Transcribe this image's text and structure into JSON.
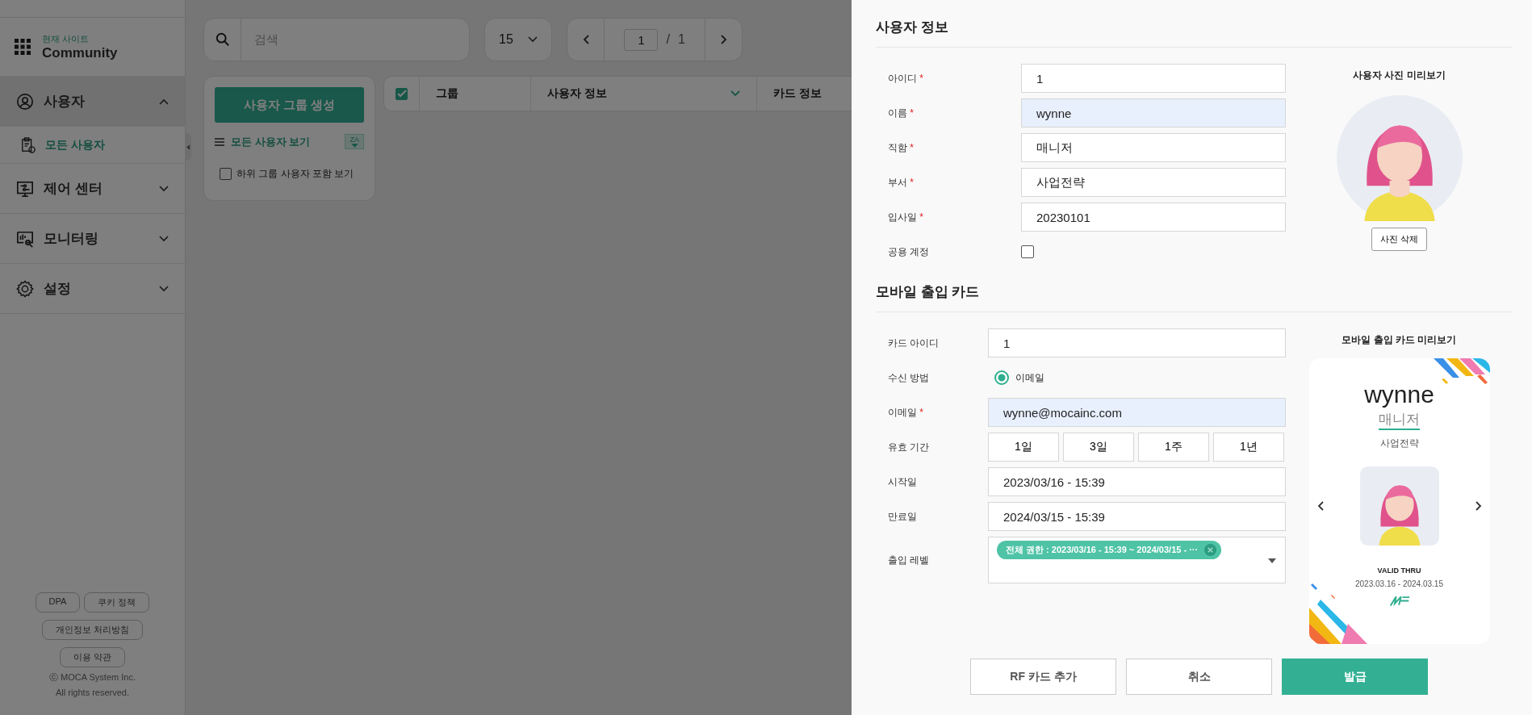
{
  "sidebar": {
    "site_label": "현재 사이트",
    "site_name": "Community",
    "menu": [
      {
        "label": "사용자",
        "kind": "user",
        "expanded": true,
        "children": [
          {
            "label": "모든 사용자",
            "selected": true
          }
        ]
      },
      {
        "label": "제어 센터",
        "kind": "control",
        "expanded": false
      },
      {
        "label": "모니터링",
        "kind": "monitor",
        "expanded": false
      },
      {
        "label": "설정",
        "kind": "settings",
        "expanded": false
      }
    ],
    "footer_links": [
      [
        "DPA",
        "쿠키 정책"
      ],
      [
        "개인정보 처리방침"
      ],
      [
        "이용 약관"
      ]
    ],
    "copyright": [
      "ⓒ MOCA System Inc.",
      "All rights reserved."
    ]
  },
  "toolbar": {
    "search": {
      "placeholder": "검색"
    },
    "page_size": "15",
    "page": "1",
    "page_sep": "/",
    "total_pages": "1"
  },
  "group_panel": {
    "create_button": "사용자 그룹 생성",
    "view_all": "모든 사용자 보기",
    "sort_badge": "ZA",
    "include_subgroups": {
      "label": "하위 그룹 사용자 포함 보기",
      "checked": false
    }
  },
  "table": {
    "select_all_checked": true,
    "columns": [
      {
        "label": "그룹",
        "sortable": false
      },
      {
        "label": "사용자 정보",
        "sortable": true
      },
      {
        "label": "카드 정보",
        "sortable": false
      }
    ]
  },
  "user_info": {
    "title": "사용자 정보",
    "rows": [
      {
        "kind": "text",
        "label": "아이디",
        "mark": "*",
        "value": "1",
        "autofilled": false
      },
      {
        "kind": "text",
        "label": "이름",
        "mark": "*",
        "value": "wynne",
        "autofilled": true
      },
      {
        "kind": "text",
        "label": "직함",
        "mark": "*",
        "value": "매니저",
        "autofilled": false
      },
      {
        "kind": "text",
        "label": "부서",
        "mark": "*",
        "value": "사업전략",
        "autofilled": false
      },
      {
        "kind": "text",
        "label": "입사일",
        "mark": "*",
        "value": "20230101",
        "autofilled": false
      },
      {
        "kind": "checkbox",
        "label": "공용 계정",
        "checked": false
      }
    ],
    "preview": {
      "title": "사용자 사진 미리보기",
      "delete_button": "사진 삭제"
    }
  },
  "mobile_card": {
    "title": "모바일 출입 카드",
    "rows": [
      {
        "kind": "text",
        "label": "카드 아이디",
        "value": "1",
        "autofilled": false
      },
      {
        "kind": "radio",
        "label": "수신 방법",
        "options": [
          {
            "label": "이메일",
            "selected": true
          }
        ]
      },
      {
        "kind": "text",
        "label": "이메일",
        "mark": "*",
        "value": "wynne@mocainc.com",
        "autofilled": true
      },
      {
        "kind": "period",
        "label": "유효 기간",
        "options": [
          "1일",
          "3일",
          "1주",
          "1년"
        ]
      },
      {
        "kind": "text",
        "label": "시작일",
        "value": "2023/03/16 - 15:39",
        "autofilled": false
      },
      {
        "kind": "text",
        "label": "만료일",
        "value": "2024/03/15 - 15:39",
        "autofilled": false
      },
      {
        "kind": "tags",
        "label": "출입 레벨",
        "tags": [
          "전체 권한 : 2023/03/16 - 15:39 ~ 2024/03/15 - ···"
        ]
      }
    ],
    "preview": {
      "title": "모바일 출입 카드 미리보기",
      "name": "wynne",
      "position": "매니저",
      "department": "사업전략",
      "valid_label": "VALID THRU",
      "valid_range": "2023.03.16 - 2024.03.15"
    }
  },
  "actions": [
    {
      "label": "RF 카드 추가",
      "primary": false
    },
    {
      "label": "취소",
      "primary": false
    },
    {
      "label": "발급",
      "primary": true
    }
  ]
}
